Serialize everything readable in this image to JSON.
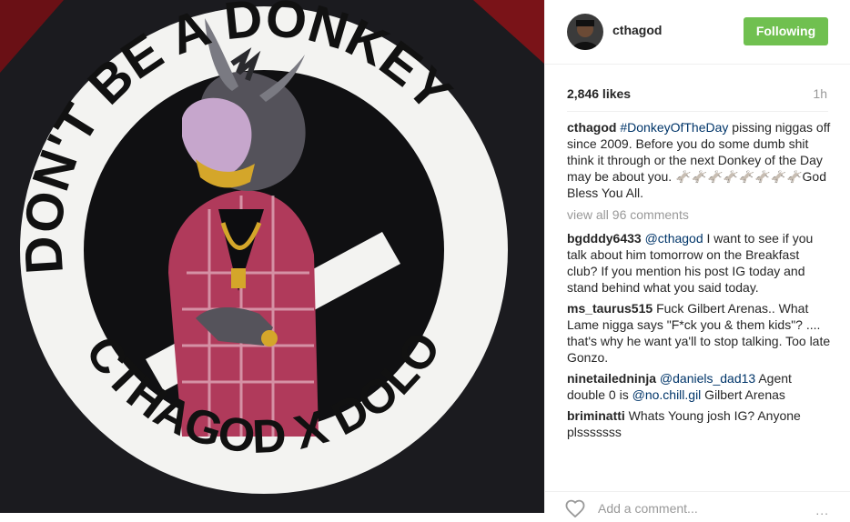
{
  "post": {
    "image": {
      "top_text": "DON'T BE A DONKEY",
      "bottom_text": "CTHAGOD X DOLO"
    },
    "header": {
      "username": "cthagod",
      "follow_label": "Following"
    },
    "likes": "2,846 likes",
    "time": "1h",
    "caption": {
      "user": "cthagod",
      "hashtag": "#DonkeyOfTheDay",
      "text": " pissing niggas off since 2009. Before you do some dumb shit think it through or the next Donkey of the Day may be about you. 🫏🫏🫏🫏🫏🫏🫏🫏God Bless You All."
    },
    "view_all": "view all 96 comments",
    "comments": [
      {
        "user": "bgdddy6433",
        "mention": "@cthagod",
        "text": " I want to see if you talk about him tomorrow on the Breakfast club? If you mention his post IG today and stand behind what you said today."
      },
      {
        "user": "ms_taurus515",
        "text": "Fuck Gilbert Arenas.. What Lame nigga says \"F*ck you & them kids\"? .... that's why he want ya'll to stop talking. Too late Gonzo."
      },
      {
        "user": "ninetailedninja",
        "mention": "@daniels_dad13",
        "text": " Agent double 0 is ",
        "mention2": "@no.chill.gil",
        "text2": " Gilbert Arenas"
      },
      {
        "user": "briminatti",
        "text": "Whats Young josh IG? Anyone plsssssss"
      }
    ],
    "add_comment_placeholder": "Add a comment...",
    "more_label": "...",
    "colors": {
      "follow_button": "#70c050",
      "link": "#003569"
    }
  }
}
